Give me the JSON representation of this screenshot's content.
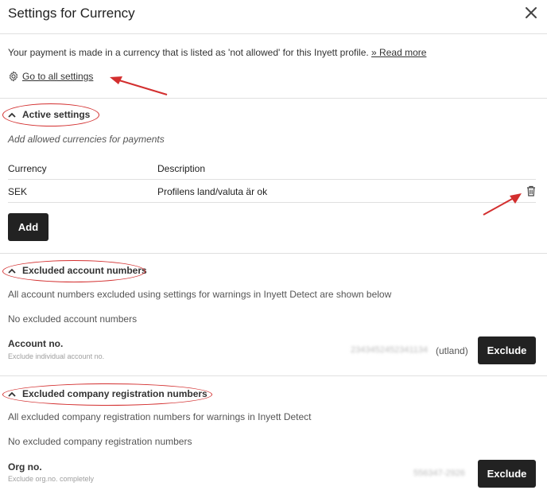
{
  "header": {
    "title": "Settings for Currency",
    "close_icon": "close-icon"
  },
  "intro": {
    "message": "Your payment is made in a currency that is listed as 'not allowed' for this Inyett profile.",
    "read_more": "» Read more",
    "settings_link": "Go to all settings",
    "settings_icon": "gear-icon"
  },
  "active_settings": {
    "header": "Active settings",
    "hint": "Add allowed currencies for payments",
    "columns": [
      "Currency",
      "Description"
    ],
    "rows": [
      {
        "currency": "SEK",
        "description": "Profilens land/valuta är ok"
      }
    ],
    "add_label": "Add",
    "delete_icon": "trash-icon"
  },
  "excluded_accounts": {
    "header": "Excluded account numbers",
    "description": "All account numbers excluded using settings for warnings in Inyett Detect are shown below",
    "empty": "No excluded account numbers",
    "field_label": "Account no.",
    "field_hint": "Exclude individual account no.",
    "value": "2343452452341134",
    "suffix": "(utland)",
    "exclude_label": "Exclude"
  },
  "excluded_orgs": {
    "header": "Excluded company registration numbers",
    "description": "All excluded company registration numbers for warnings in Inyett Detect",
    "empty": "No excluded company registration numbers",
    "field_label": "Org no.",
    "field_hint": "Exclude org.no. completely",
    "value": "556347-2926",
    "exclude_label": "Exclude"
  },
  "colors": {
    "annotation": "#d32f2f",
    "button_bg": "#222222",
    "divider": "#e0e0e0"
  }
}
